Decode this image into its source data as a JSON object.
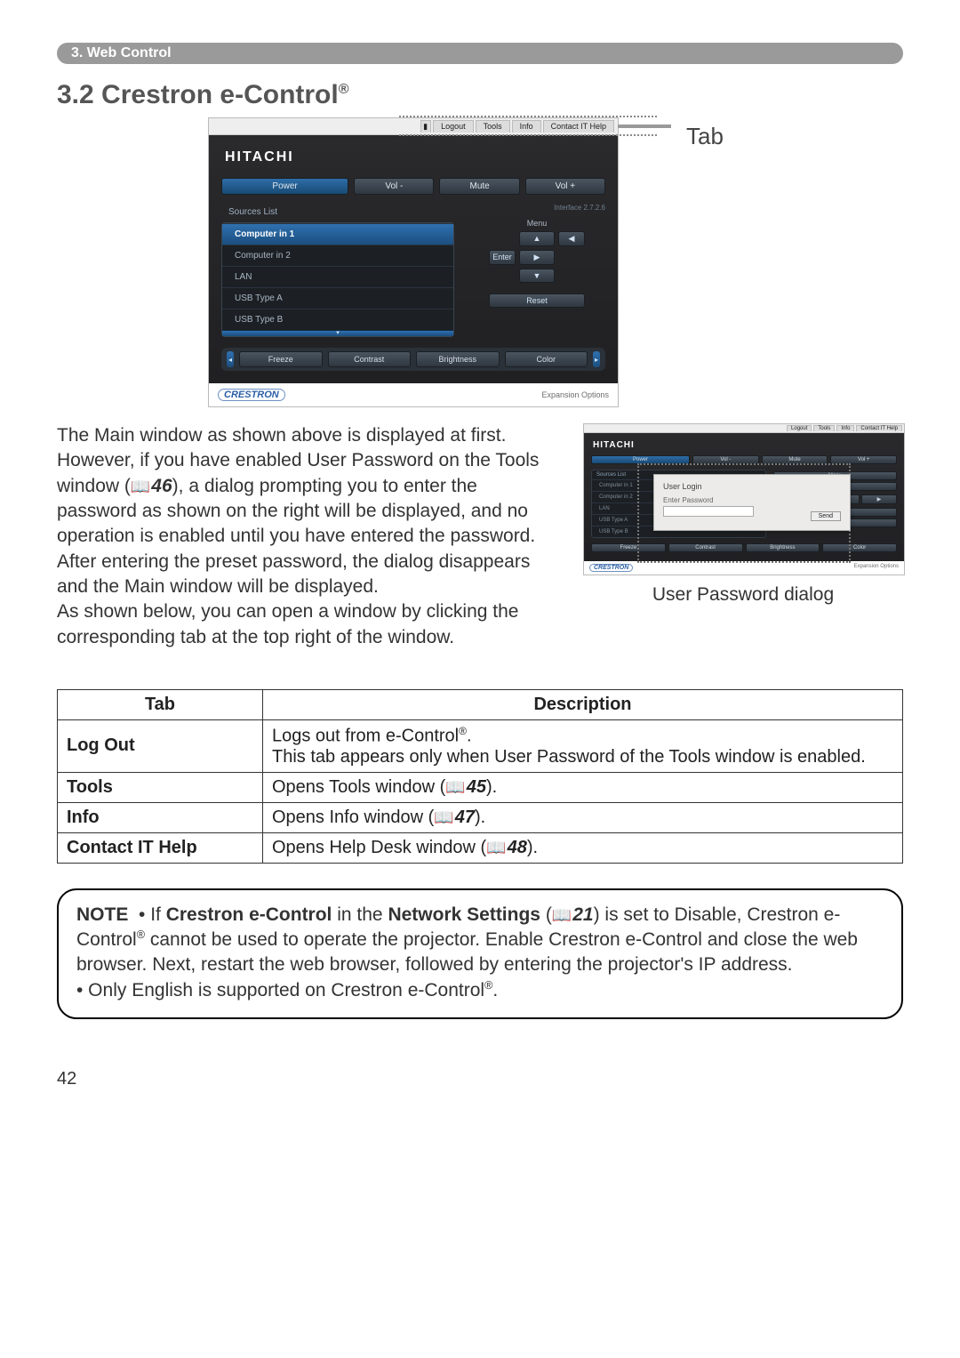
{
  "breadcrumb": "3. Web Control",
  "section_title_num": "3.2 ",
  "section_title_main": "Crestron e-Control",
  "tab_pointer": "Tab",
  "fig_main": {
    "tabs": {
      "spacer": "",
      "logout": "Logout",
      "tools": "Tools",
      "info": "Info",
      "contact": "Contact IT Help"
    },
    "brand": "HITACHI",
    "buttons": {
      "power": "Power",
      "volminus": "Vol -",
      "mute": "Mute",
      "volplus": "Vol +"
    },
    "interface": "Interface 2.7.2.6",
    "sources_title": "Sources List",
    "sources": [
      "Computer in 1",
      "Computer in 2",
      "LAN",
      "USB Type A",
      "USB Type B"
    ],
    "menu_label": "Menu",
    "dpad": {
      "up": "▲",
      "left": "◀",
      "enter": "Enter",
      "right": "▶",
      "down": "▼",
      "reset": "Reset"
    },
    "adjust": {
      "freeze": "Freeze",
      "contrast": "Contrast",
      "brightness": "Brightness",
      "color": "Color"
    },
    "footer_logo": "CRESTRON",
    "footer_right": "Expansion Options"
  },
  "para1": "The Main window as shown above is displayed at first. However, if you have enabled User Password on the Tools window (",
  "para1_ref": "46",
  "para1b": "), a dialog prompting you to enter the password as shown on the right will be displayed, and no operation is enabled until you have entered the password. After entering the preset password, the dialog disappears and the Main window will be displayed.",
  "para2": "As shown below, you can open a window by clicking the corresponding tab at the top right of the window.",
  "dialog": {
    "title": "User Login",
    "label": "Enter Password",
    "send": "Send",
    "caption": "User Password dialog"
  },
  "table": {
    "head_tab": "Tab",
    "head_desc": "Description",
    "rows": [
      {
        "tab": "Log Out",
        "desc_a": "Logs out from e-Control",
        "desc_b": ".\nThis tab appears only when User Password of the Tools window is enabled."
      },
      {
        "tab": "Tools",
        "desc": "Opens Tools window (",
        "ref": "45",
        "tail": ")."
      },
      {
        "tab": "Info",
        "desc": "Opens Info window (",
        "ref": "47",
        "tail": ")."
      },
      {
        "tab": "Contact IT Help",
        "desc": "Opens Help Desk window (",
        "ref": "48",
        "tail": ")."
      }
    ]
  },
  "note": {
    "lead": "NOTE",
    "l1a": "• If ",
    "l1b": "Crestron e-Control",
    "l1c": " in the ",
    "l1d": "Network Settings",
    "l1e": " (",
    "l1_ref": "21",
    "l1f": ") is set to Disable, Crestron e-Control",
    "l1g": " cannot be used to operate the projector. Enable Crestron e-Control and close the web browser. Next, restart the web browser, followed by entering the projector's IP address.",
    "l2a": "• Only English is supported on Crestron e-Control",
    "l2b": "."
  },
  "page_number": "42"
}
